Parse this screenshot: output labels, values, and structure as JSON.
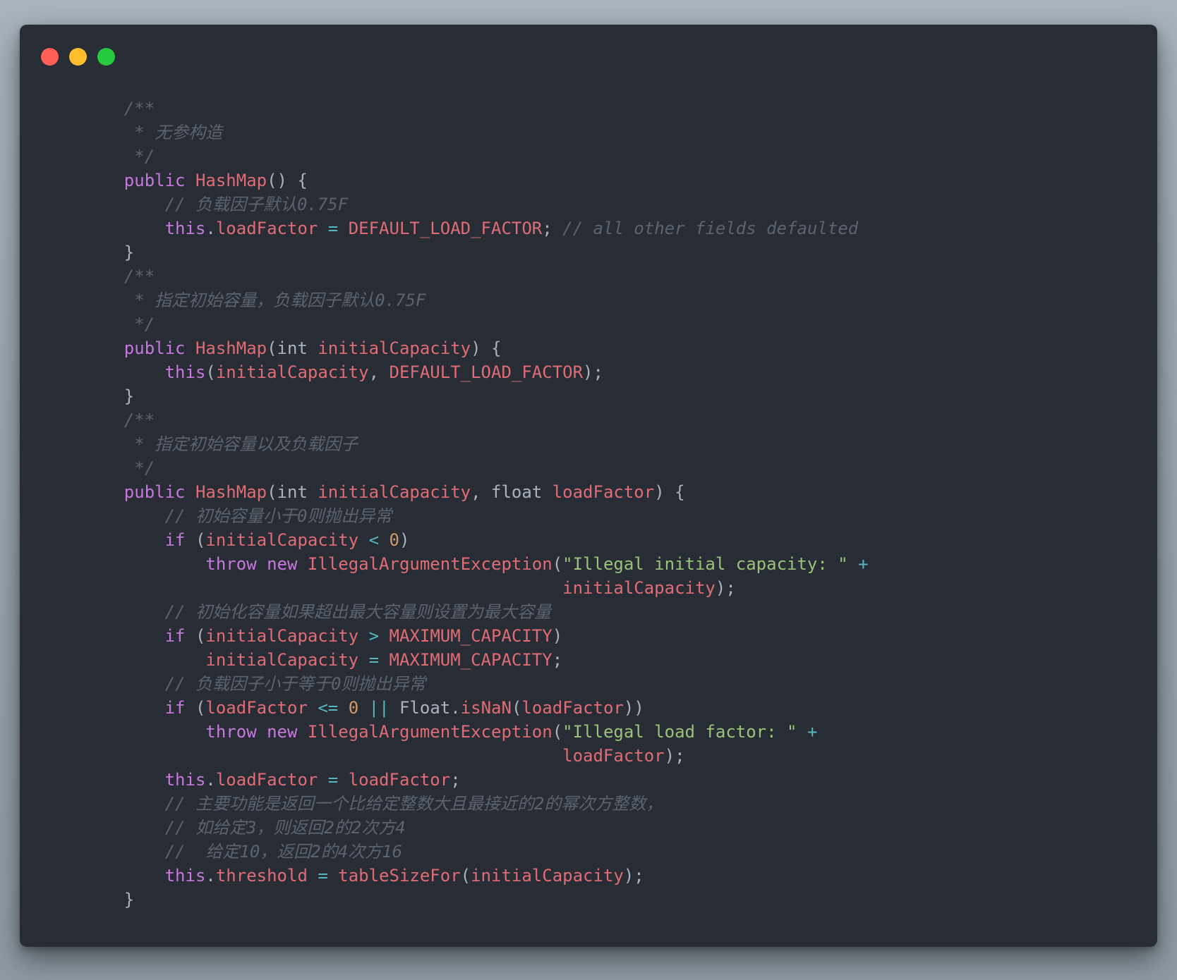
{
  "window": {
    "controls": [
      {
        "name": "close",
        "color": "#ff5f56"
      },
      {
        "name": "minimize",
        "color": "#ffbd2e"
      },
      {
        "name": "maximize",
        "color": "#27c93f"
      }
    ]
  },
  "colors": {
    "background": "#282c34",
    "comment": "#5c6370",
    "keyword": "#c678dd",
    "identifier": "#e06c75",
    "plain": "#abb2bf",
    "operator": "#56b6c2",
    "number": "#d19a66",
    "string": "#98c379"
  },
  "code_lines": [
    [
      {
        "t": "    /**",
        "c": "comment"
      }
    ],
    [
      {
        "t": "     * 无参构造",
        "c": "comment"
      }
    ],
    [
      {
        "t": "     */",
        "c": "comment"
      }
    ],
    [
      {
        "t": "    ",
        "c": "plain"
      },
      {
        "t": "public",
        "c": "keyword"
      },
      {
        "t": " ",
        "c": "plain"
      },
      {
        "t": "HashMap",
        "c": "function"
      },
      {
        "t": "() {",
        "c": "plain"
      }
    ],
    [
      {
        "t": "        ",
        "c": "plain"
      },
      {
        "t": "// 负载因子默认0.75F",
        "c": "comment"
      }
    ],
    [
      {
        "t": "        ",
        "c": "plain"
      },
      {
        "t": "this",
        "c": "keyword"
      },
      {
        "t": ".",
        "c": "plain"
      },
      {
        "t": "loadFactor",
        "c": "ident"
      },
      {
        "t": " ",
        "c": "plain"
      },
      {
        "t": "=",
        "c": "operator"
      },
      {
        "t": " ",
        "c": "plain"
      },
      {
        "t": "DEFAULT_LOAD_FACTOR",
        "c": "ident"
      },
      {
        "t": "; ",
        "c": "plain"
      },
      {
        "t": "// all other fields defaulted",
        "c": "comment"
      }
    ],
    [
      {
        "t": "    }",
        "c": "plain"
      }
    ],
    [
      {
        "t": "    /**",
        "c": "comment"
      }
    ],
    [
      {
        "t": "     * 指定初始容量，负载因子默认0.75F",
        "c": "comment"
      }
    ],
    [
      {
        "t": "     */",
        "c": "comment"
      }
    ],
    [
      {
        "t": "    ",
        "c": "plain"
      },
      {
        "t": "public",
        "c": "keyword"
      },
      {
        "t": " ",
        "c": "plain"
      },
      {
        "t": "HashMap",
        "c": "function"
      },
      {
        "t": "(int ",
        "c": "plain"
      },
      {
        "t": "initialCapacity",
        "c": "ident"
      },
      {
        "t": ") {",
        "c": "plain"
      }
    ],
    [
      {
        "t": "        ",
        "c": "plain"
      },
      {
        "t": "this",
        "c": "keyword"
      },
      {
        "t": "(",
        "c": "plain"
      },
      {
        "t": "initialCapacity",
        "c": "ident"
      },
      {
        "t": ", ",
        "c": "plain"
      },
      {
        "t": "DEFAULT_LOAD_FACTOR",
        "c": "ident"
      },
      {
        "t": ");",
        "c": "plain"
      }
    ],
    [
      {
        "t": "    }",
        "c": "plain"
      }
    ],
    [
      {
        "t": "    /**",
        "c": "comment"
      }
    ],
    [
      {
        "t": "     * 指定初始容量以及负载因子",
        "c": "comment"
      }
    ],
    [
      {
        "t": "     */",
        "c": "comment"
      }
    ],
    [
      {
        "t": "    ",
        "c": "plain"
      },
      {
        "t": "public",
        "c": "keyword"
      },
      {
        "t": " ",
        "c": "plain"
      },
      {
        "t": "HashMap",
        "c": "function"
      },
      {
        "t": "(int ",
        "c": "plain"
      },
      {
        "t": "initialCapacity",
        "c": "ident"
      },
      {
        "t": ", float ",
        "c": "plain"
      },
      {
        "t": "loadFactor",
        "c": "ident"
      },
      {
        "t": ") {",
        "c": "plain"
      }
    ],
    [
      {
        "t": "        ",
        "c": "plain"
      },
      {
        "t": "// 初始容量小于0则抛出异常",
        "c": "comment"
      }
    ],
    [
      {
        "t": "        ",
        "c": "plain"
      },
      {
        "t": "if",
        "c": "keyword"
      },
      {
        "t": " (",
        "c": "plain"
      },
      {
        "t": "initialCapacity",
        "c": "ident"
      },
      {
        "t": " ",
        "c": "plain"
      },
      {
        "t": "<",
        "c": "operator"
      },
      {
        "t": " ",
        "c": "plain"
      },
      {
        "t": "0",
        "c": "number"
      },
      {
        "t": ")",
        "c": "plain"
      }
    ],
    [
      {
        "t": "            ",
        "c": "plain"
      },
      {
        "t": "throw",
        "c": "keyword"
      },
      {
        "t": " ",
        "c": "plain"
      },
      {
        "t": "new",
        "c": "keyword"
      },
      {
        "t": " ",
        "c": "plain"
      },
      {
        "t": "IllegalArgumentException",
        "c": "function"
      },
      {
        "t": "(",
        "c": "plain"
      },
      {
        "t": "\"Illegal initial capacity: \"",
        "c": "string"
      },
      {
        "t": " ",
        "c": "plain"
      },
      {
        "t": "+",
        "c": "operator"
      }
    ],
    [
      {
        "t": "                                               ",
        "c": "plain"
      },
      {
        "t": "initialCapacity",
        "c": "ident"
      },
      {
        "t": ");",
        "c": "plain"
      }
    ],
    [
      {
        "t": "        ",
        "c": "plain"
      },
      {
        "t": "// 初始化容量如果超出最大容量则设置为最大容量",
        "c": "comment"
      }
    ],
    [
      {
        "t": "        ",
        "c": "plain"
      },
      {
        "t": "if",
        "c": "keyword"
      },
      {
        "t": " (",
        "c": "plain"
      },
      {
        "t": "initialCapacity",
        "c": "ident"
      },
      {
        "t": " ",
        "c": "plain"
      },
      {
        "t": ">",
        "c": "operator"
      },
      {
        "t": " ",
        "c": "plain"
      },
      {
        "t": "MAXIMUM_CAPACITY",
        "c": "ident"
      },
      {
        "t": ")",
        "c": "plain"
      }
    ],
    [
      {
        "t": "            ",
        "c": "plain"
      },
      {
        "t": "initialCapacity",
        "c": "ident"
      },
      {
        "t": " ",
        "c": "plain"
      },
      {
        "t": "=",
        "c": "operator"
      },
      {
        "t": " ",
        "c": "plain"
      },
      {
        "t": "MAXIMUM_CAPACITY",
        "c": "ident"
      },
      {
        "t": ";",
        "c": "plain"
      }
    ],
    [
      {
        "t": "        ",
        "c": "plain"
      },
      {
        "t": "// 负载因子小于等于0则抛出异常",
        "c": "comment"
      }
    ],
    [
      {
        "t": "        ",
        "c": "plain"
      },
      {
        "t": "if",
        "c": "keyword"
      },
      {
        "t": " (",
        "c": "plain"
      },
      {
        "t": "loadFactor",
        "c": "ident"
      },
      {
        "t": " ",
        "c": "plain"
      },
      {
        "t": "<=",
        "c": "operator"
      },
      {
        "t": " ",
        "c": "plain"
      },
      {
        "t": "0",
        "c": "number"
      },
      {
        "t": " ",
        "c": "plain"
      },
      {
        "t": "||",
        "c": "operator"
      },
      {
        "t": " Float.",
        "c": "plain"
      },
      {
        "t": "isNaN",
        "c": "function"
      },
      {
        "t": "(",
        "c": "plain"
      },
      {
        "t": "loadFactor",
        "c": "ident"
      },
      {
        "t": "))",
        "c": "plain"
      }
    ],
    [
      {
        "t": "            ",
        "c": "plain"
      },
      {
        "t": "throw",
        "c": "keyword"
      },
      {
        "t": " ",
        "c": "plain"
      },
      {
        "t": "new",
        "c": "keyword"
      },
      {
        "t": " ",
        "c": "plain"
      },
      {
        "t": "IllegalArgumentException",
        "c": "function"
      },
      {
        "t": "(",
        "c": "plain"
      },
      {
        "t": "\"Illegal load factor: \"",
        "c": "string"
      },
      {
        "t": " ",
        "c": "plain"
      },
      {
        "t": "+",
        "c": "operator"
      }
    ],
    [
      {
        "t": "                                               ",
        "c": "plain"
      },
      {
        "t": "loadFactor",
        "c": "ident"
      },
      {
        "t": ");",
        "c": "plain"
      }
    ],
    [
      {
        "t": "        ",
        "c": "plain"
      },
      {
        "t": "this",
        "c": "keyword"
      },
      {
        "t": ".",
        "c": "plain"
      },
      {
        "t": "loadFactor",
        "c": "ident"
      },
      {
        "t": " ",
        "c": "plain"
      },
      {
        "t": "=",
        "c": "operator"
      },
      {
        "t": " ",
        "c": "plain"
      },
      {
        "t": "loadFactor",
        "c": "ident"
      },
      {
        "t": ";",
        "c": "plain"
      }
    ],
    [
      {
        "t": "        ",
        "c": "plain"
      },
      {
        "t": "// 主要功能是返回一个比给定整数大且最接近的2的幂次方整数，",
        "c": "comment"
      }
    ],
    [
      {
        "t": "        ",
        "c": "plain"
      },
      {
        "t": "// 如给定3，则返回2的2次方4",
        "c": "comment"
      }
    ],
    [
      {
        "t": "        ",
        "c": "plain"
      },
      {
        "t": "//  给定10，返回2的4次方16",
        "c": "comment"
      }
    ],
    [
      {
        "t": "        ",
        "c": "plain"
      },
      {
        "t": "this",
        "c": "keyword"
      },
      {
        "t": ".",
        "c": "plain"
      },
      {
        "t": "threshold",
        "c": "ident"
      },
      {
        "t": " ",
        "c": "plain"
      },
      {
        "t": "=",
        "c": "operator"
      },
      {
        "t": " ",
        "c": "plain"
      },
      {
        "t": "tableSizeFor",
        "c": "function"
      },
      {
        "t": "(",
        "c": "plain"
      },
      {
        "t": "initialCapacity",
        "c": "ident"
      },
      {
        "t": ");",
        "c": "plain"
      }
    ],
    [
      {
        "t": "    }",
        "c": "plain"
      }
    ]
  ]
}
